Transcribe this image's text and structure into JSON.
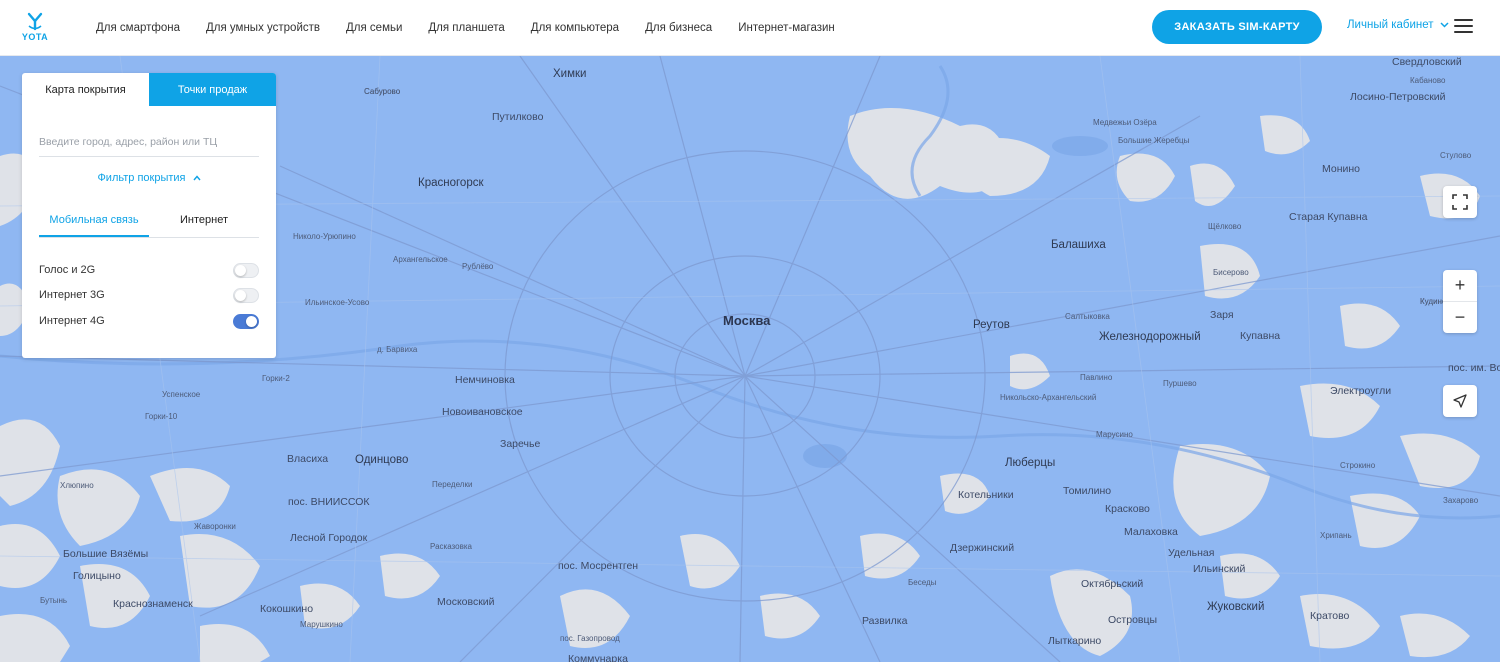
{
  "header": {
    "logo_text": "YOTA",
    "nav": [
      "Для смартфона",
      "Для умных устройств",
      "Для семьи",
      "Для планшета",
      "Для компьютера",
      "Для бизнеса",
      "Интернет-магазин"
    ],
    "order_button": "ЗАКАЗАТЬ SIM-КАРТУ",
    "cabinet_label": "Личный кабинет"
  },
  "panel": {
    "tabs": [
      "Карта покрытия",
      "Точки продаж"
    ],
    "active_tab": 1,
    "search_placeholder": "Введите город, адрес, район или ТЦ",
    "filter_label": "Фильтр покрытия",
    "subtabs": [
      "Мобильная связь",
      "Интернет"
    ],
    "toggles": [
      {
        "label": "Голос и 2G",
        "on": false
      },
      {
        "label": "Интернет 3G",
        "on": false
      },
      {
        "label": "Интернет 4G",
        "on": true
      }
    ]
  },
  "map": {
    "places": [
      {
        "name": "Москва",
        "cls": "capital"
      },
      {
        "name": "Химки",
        "cls": "city"
      },
      {
        "name": "Красногорск",
        "cls": "city"
      },
      {
        "name": "Путилково",
        "cls": ""
      },
      {
        "name": "Балашиха",
        "cls": "city"
      },
      {
        "name": "Реутов",
        "cls": "city"
      },
      {
        "name": "Железнодорожный",
        "cls": "city"
      },
      {
        "name": "Люберцы",
        "cls": "city"
      },
      {
        "name": "Котельники",
        "cls": ""
      },
      {
        "name": "Одинцово",
        "cls": "city"
      },
      {
        "name": "Немчиновка",
        "cls": ""
      },
      {
        "name": "Новоивановское",
        "cls": ""
      },
      {
        "name": "Заречье",
        "cls": ""
      },
      {
        "name": "Власиха",
        "cls": ""
      },
      {
        "name": "пос. ВНИИССОК",
        "cls": ""
      },
      {
        "name": "Лесной Городок",
        "cls": ""
      },
      {
        "name": "Большие Вязёмы",
        "cls": ""
      },
      {
        "name": "Голицыно",
        "cls": ""
      },
      {
        "name": "Краснознаменск",
        "cls": ""
      },
      {
        "name": "Кокошкино",
        "cls": ""
      },
      {
        "name": "Московский",
        "cls": ""
      },
      {
        "name": "пос. Мосрентген",
        "cls": ""
      },
      {
        "name": "Развилка",
        "cls": ""
      },
      {
        "name": "Дзержинский",
        "cls": ""
      },
      {
        "name": "Томилино",
        "cls": ""
      },
      {
        "name": "Красково",
        "cls": ""
      },
      {
        "name": "Малаховка",
        "cls": ""
      },
      {
        "name": "Удельная",
        "cls": ""
      },
      {
        "name": "Ильинский",
        "cls": ""
      },
      {
        "name": "Октябрьский",
        "cls": ""
      },
      {
        "name": "Жуковский",
        "cls": "city"
      },
      {
        "name": "Кратово",
        "cls": ""
      },
      {
        "name": "Островцы",
        "cls": ""
      },
      {
        "name": "Лыткарино",
        "cls": ""
      },
      {
        "name": "Коммунарка",
        "cls": ""
      },
      {
        "name": "Старая Купавна",
        "cls": ""
      },
      {
        "name": "Монино",
        "cls": ""
      },
      {
        "name": "Лосино-Петровский",
        "cls": ""
      },
      {
        "name": "Заря",
        "cls": ""
      },
      {
        "name": "Купавна",
        "cls": ""
      },
      {
        "name": "Электроугли",
        "cls": ""
      },
      {
        "name": "пос. им. Воровского",
        "cls": ""
      },
      {
        "name": "Свердловский",
        "cls": ""
      },
      {
        "name": "Сабурово",
        "cls": "small"
      },
      {
        "name": "Николо-Урюпино",
        "cls": "small"
      },
      {
        "name": "Архангельское",
        "cls": "small"
      },
      {
        "name": "Рублёво",
        "cls": "small"
      },
      {
        "name": "Ильинское-Усово",
        "cls": "small"
      },
      {
        "name": "д. Барвиха",
        "cls": "small"
      },
      {
        "name": "Горки-2",
        "cls": "small"
      },
      {
        "name": "Успенское",
        "cls": "small"
      },
      {
        "name": "Горки-10",
        "cls": "small"
      },
      {
        "name": "Переделки",
        "cls": "small"
      },
      {
        "name": "Жаворонки",
        "cls": "small"
      },
      {
        "name": "Расказовка",
        "cls": "small"
      },
      {
        "name": "Марушкино",
        "cls": "small"
      },
      {
        "name": "пос. Газопровод",
        "cls": "small"
      },
      {
        "name": "Салтыковка",
        "cls": "small"
      },
      {
        "name": "Никольско-Архангельский",
        "cls": "small"
      },
      {
        "name": "Павлино",
        "cls": "small"
      },
      {
        "name": "Пуршево",
        "cls": "small"
      },
      {
        "name": "Марусино",
        "cls": "small"
      },
      {
        "name": "Бисерово",
        "cls": "small"
      },
      {
        "name": "Кудиново",
        "cls": "small"
      },
      {
        "name": "Стулово",
        "cls": "small"
      },
      {
        "name": "Кабаново",
        "cls": "small"
      },
      {
        "name": "Медвежьи Озёра",
        "cls": "small"
      },
      {
        "name": "Большие Жеребцы",
        "cls": "small"
      },
      {
        "name": "Щёлково",
        "cls": "small"
      },
      {
        "name": "Сабурово",
        "cls": "small"
      },
      {
        "name": "Кудиново",
        "cls": "small"
      },
      {
        "name": "Захарово",
        "cls": "small"
      },
      {
        "name": "Строкино",
        "cls": "small"
      },
      {
        "name": "Хрипань",
        "cls": "small"
      },
      {
        "name": "Бутынь",
        "cls": "small"
      },
      {
        "name": "Хлюпино",
        "cls": "small"
      },
      {
        "name": "Беседы",
        "cls": "small"
      }
    ]
  },
  "controls": {
    "fullscreen_icon": "expand-icon",
    "zoom_in": "+",
    "zoom_out": "−",
    "locate_icon": "locate-arrow-icon"
  },
  "colors": {
    "accent": "#0fa3e6",
    "coverage": "#8fb7f2",
    "toggle_on": "#4a7bd6"
  }
}
